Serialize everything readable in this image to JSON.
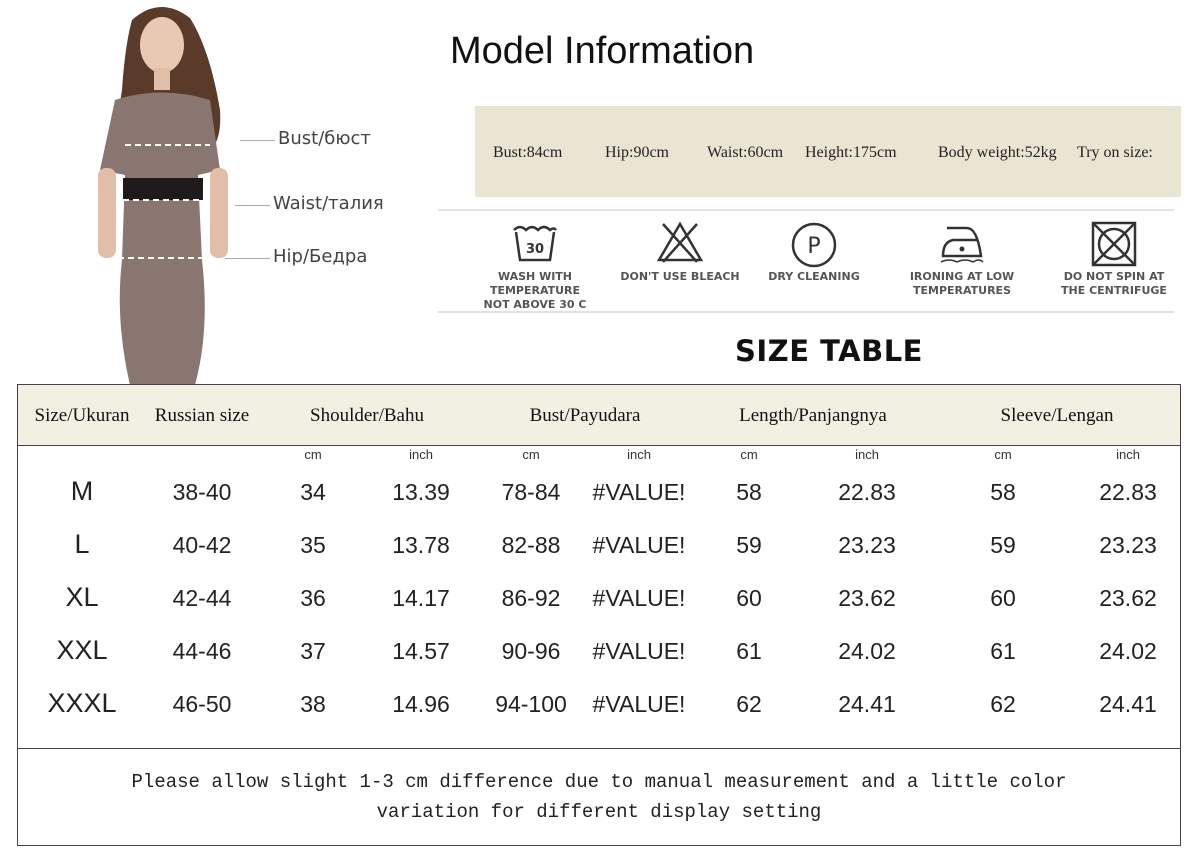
{
  "model": {
    "bust": "Bust/бюст",
    "waist": "Waist/талия",
    "hip": "Hip/Бедра"
  },
  "title": "Model Information",
  "stats": {
    "bust": "Bust:84cm",
    "hip": "Hip:90cm",
    "waist": "Waist:60cm",
    "height": "Height:175cm",
    "weight": "Body weight:52kg",
    "try": "Try on size:"
  },
  "care": [
    {
      "icon": "wash-30-icon",
      "line1": "WASH WITH TEMPERATURE",
      "line2": "NOT ABOVE 30 C",
      "temp": "30"
    },
    {
      "icon": "no-bleach-icon",
      "line1": "DON'T USE BLEACH",
      "line2": ""
    },
    {
      "icon": "dry-cleaning-icon",
      "line1": "DRY CLEANING",
      "line2": "",
      "letter": "P"
    },
    {
      "icon": "iron-low-icon",
      "line1": "IRONING AT LOW",
      "line2": "TEMPERATURES"
    },
    {
      "icon": "no-spin-icon",
      "line1": "DO NOT SPIN AT",
      "line2": "THE CENTRIFUGE"
    }
  ],
  "size_title": "SIZE TABLE",
  "table": {
    "headers": [
      "Size/Ukuran",
      "Russian size",
      "Shoulder/Bahu",
      "Bust/Payudara",
      "Length/Panjangnya",
      "Sleeve/Lengan"
    ],
    "units": [
      "cm",
      "inch",
      "cm",
      "inch",
      "cm",
      "inch",
      "cm",
      "inch"
    ],
    "rows": [
      [
        "M",
        "38-40",
        "34",
        "13.39",
        "78-84",
        "#VALUE!",
        "58",
        "22.83",
        "58",
        "22.83"
      ],
      [
        "L",
        "40-42",
        "35",
        "13.78",
        "82-88",
        "#VALUE!",
        "59",
        "23.23",
        "59",
        "23.23"
      ],
      [
        "XL",
        "42-44",
        "36",
        "14.17",
        "86-92",
        "#VALUE!",
        "60",
        "23.62",
        "60",
        "23.62"
      ],
      [
        "XXL",
        "44-46",
        "37",
        "14.57",
        "90-96",
        "#VALUE!",
        "61",
        "24.02",
        "61",
        "24.02"
      ],
      [
        "XXXL",
        "46-50",
        "38",
        "14.96",
        "94-100",
        "#VALUE!",
        "62",
        "24.41",
        "62",
        "24.41"
      ]
    ]
  },
  "note": {
    "line1": "Please allow slight 1-3 cm difference due to manual measurement and a little color",
    "line2": "variation for different display setting"
  }
}
